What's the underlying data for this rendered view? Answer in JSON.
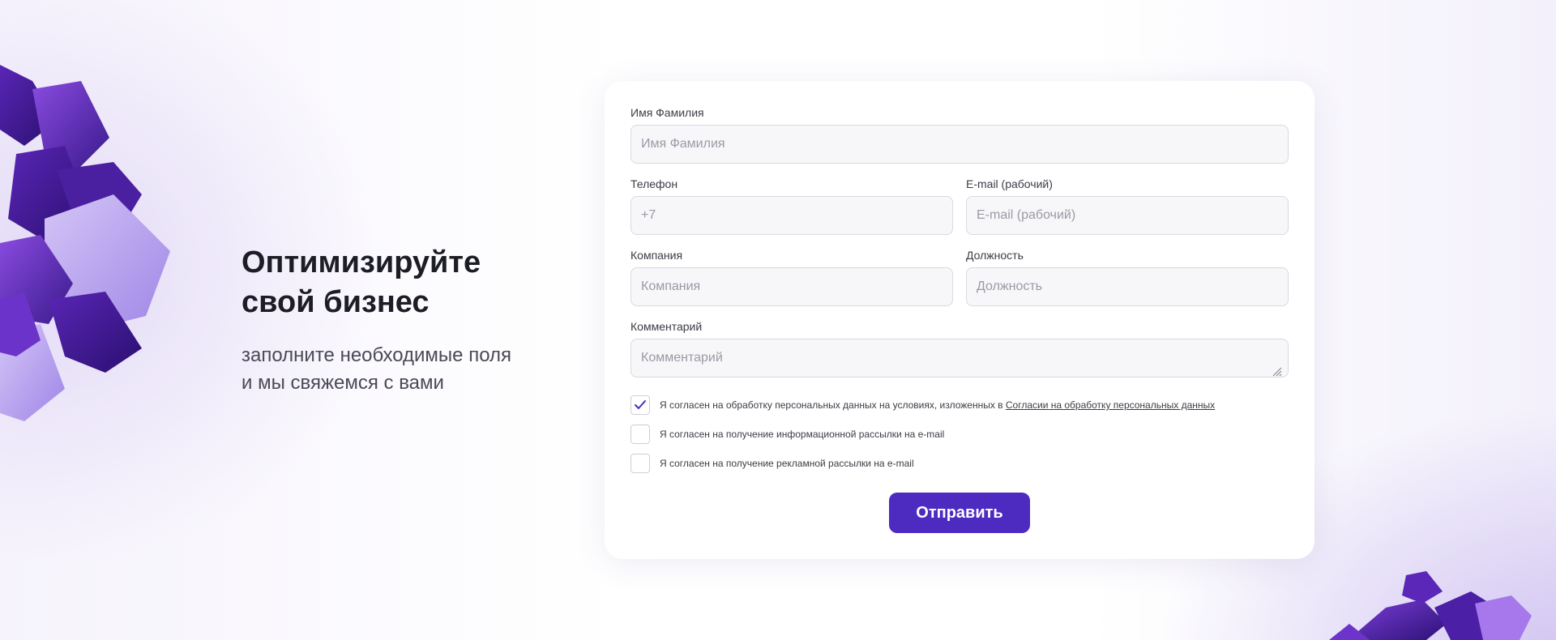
{
  "hero": {
    "title": "Оптимизируйте\nсвой бизнес",
    "subtitle": "заполните необходимые поля\nи мы свяжемся с вами"
  },
  "form": {
    "name": {
      "label": "Имя Фамилия",
      "placeholder": "Имя Фамилия",
      "value": ""
    },
    "phone": {
      "label": "Телефон",
      "placeholder": "+7",
      "value": ""
    },
    "email": {
      "label": "E-mail (рабочий)",
      "placeholder": "E-mail (рабочий)",
      "value": ""
    },
    "company": {
      "label": "Компания",
      "placeholder": "Компания",
      "value": ""
    },
    "position": {
      "label": "Должность",
      "placeholder": "Должность",
      "value": ""
    },
    "comment": {
      "label": "Комментарий",
      "placeholder": "Комментарий",
      "value": ""
    },
    "consents": [
      {
        "text": "Я согласен на обработку персональных данных на условиях, изложенных в ",
        "link": "Согласии на обработку персональных данных",
        "checked": true
      },
      {
        "text": "Я согласен на получение информационной рассылки на e-mail",
        "checked": false
      },
      {
        "text": "Я согласен на получение рекламной рассылки на e-mail",
        "checked": false
      }
    ],
    "submit_label": "Отправить"
  },
  "colors": {
    "accent": "#4d2ac0",
    "cube_dark": "#3a1a8c",
    "cube_mid": "#6b33c9",
    "cube_light": "#b9a3ee"
  },
  "icons": {
    "checked": "checkmark-icon",
    "resize": "resize-handle-icon"
  }
}
